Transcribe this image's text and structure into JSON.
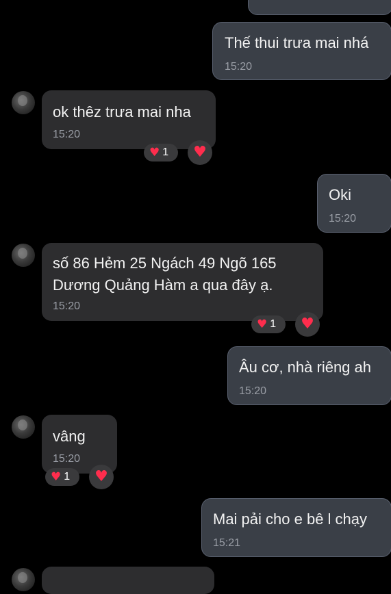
{
  "messages": [
    {
      "text": "Thế thui trưa mai nhá",
      "time": "15:20"
    },
    {
      "text": "ok thêz trưa mai nha",
      "time": "15:20",
      "reaction": {
        "count": "1"
      }
    },
    {
      "text": "Oki",
      "time": "15:20"
    },
    {
      "lines": [
        "số 86  Hẻm 25 Ngách 49 Ngõ 165",
        "Dương Quảng Hàm a qua đây ạ."
      ],
      "time": "15:20",
      "reaction": {
        "count": "1"
      }
    },
    {
      "text": "Âu cơ, nhà riêng ah",
      "time": "15:20"
    },
    {
      "text": "vâng",
      "time": "15:20",
      "reaction": {
        "count": "1"
      }
    },
    {
      "text": "Mai pải cho e bê l chạy",
      "time": "15:21"
    }
  ],
  "icons": {
    "reaction": "heart-icon",
    "avatar": "avatar"
  },
  "colors": {
    "heart": "#ff2d4d",
    "outgoing_bubble": "#3a3f47",
    "incoming_bubble": "#2d2d2f"
  }
}
